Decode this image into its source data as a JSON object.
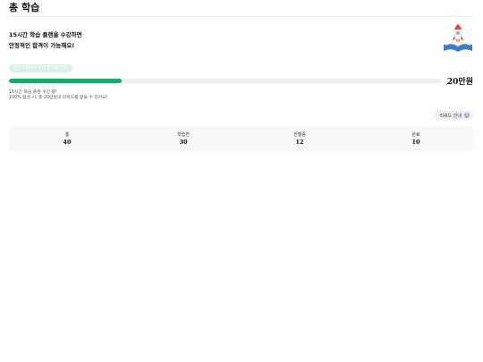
{
  "page": {
    "title": "총 학습"
  },
  "headline": {
    "line1": "15시간 학습 플랜을 수강하면",
    "line2": "안정적인 합격이 가능해요!"
  },
  "progress": {
    "pill_label": "한번 도전해서 환급 한 기회인데!",
    "fraction": 0.26,
    "reward_amount": "20만원",
    "fill_color": "#1fa66b"
  },
  "info": {
    "line1": "15시간 학습 플랜 수강 중!",
    "line2": "100% 달성 시, 총 20만원의 리워드를 받을 수 있어요!"
  },
  "reward_guide": {
    "label": "리워드 안내",
    "icon": "info-icon"
  },
  "stats": [
    {
      "label": "총",
      "value": "40"
    },
    {
      "label": "학습전",
      "value": "30"
    },
    {
      "label": "진행중",
      "value": "12"
    },
    {
      "label": "완료",
      "value": "10"
    }
  ]
}
